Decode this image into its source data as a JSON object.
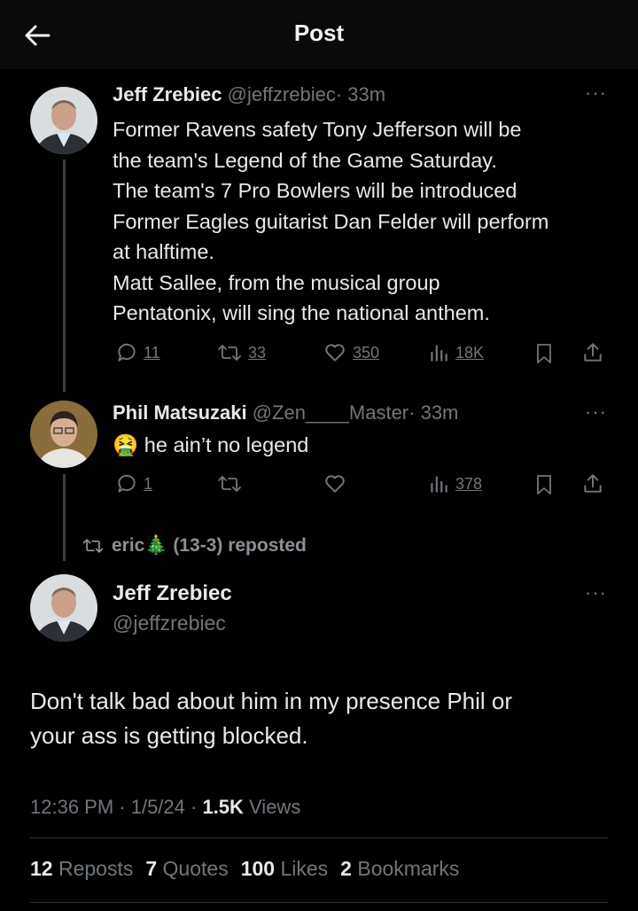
{
  "header": {
    "title": "Post"
  },
  "tweet1": {
    "name": "Jeff Zrebiec",
    "handle": "@jeffzrebiec",
    "time": "· 33m",
    "lines": [
      "Former Ravens safety Tony Jefferson will be",
      "the team's Legend of the Game Saturday.",
      "The team's 7 Pro Bowlers will be introduced",
      "Former Eagles guitarist Dan Felder will perform",
      "at halftime.",
      "Matt Sallee, from the musical group",
      "Pentatonix, will sing the national anthem."
    ],
    "replies": "11",
    "reposts": "33",
    "likes": "350",
    "views": "18K"
  },
  "tweet2": {
    "name": "Phil Matsuzaki",
    "handle": "@Zen____Master",
    "time": "· 33m",
    "emoji": "🤮",
    "text": "he ain’t no legend",
    "replies": "1",
    "views": "378"
  },
  "repost_banner": {
    "text": "eric🎄 (13-3) reposted"
  },
  "main_tweet": {
    "name": "Jeff Zrebiec",
    "handle": "@jeffzrebiec",
    "line1": "Don't talk bad about him in my presence Phil or",
    "line2": "your ass is getting blocked.",
    "meta_time": "12:36 PM · 1/5/24 · ",
    "meta_views_num": "1.5K",
    "meta_views_label": " Views"
  },
  "stats": {
    "reposts_num": "12",
    "reposts_label": " Reposts",
    "quotes_num": "7",
    "quotes_label": "Quotes",
    "likes_num": "100",
    "likes_label": " Likes",
    "bookmarks_num": "2",
    "bookmarks_label": " Bookmarks"
  },
  "colors": {
    "background": "#000000",
    "text": "#e7e9ea",
    "dim": "#71767b",
    "thread_line": "#3a3d40"
  }
}
